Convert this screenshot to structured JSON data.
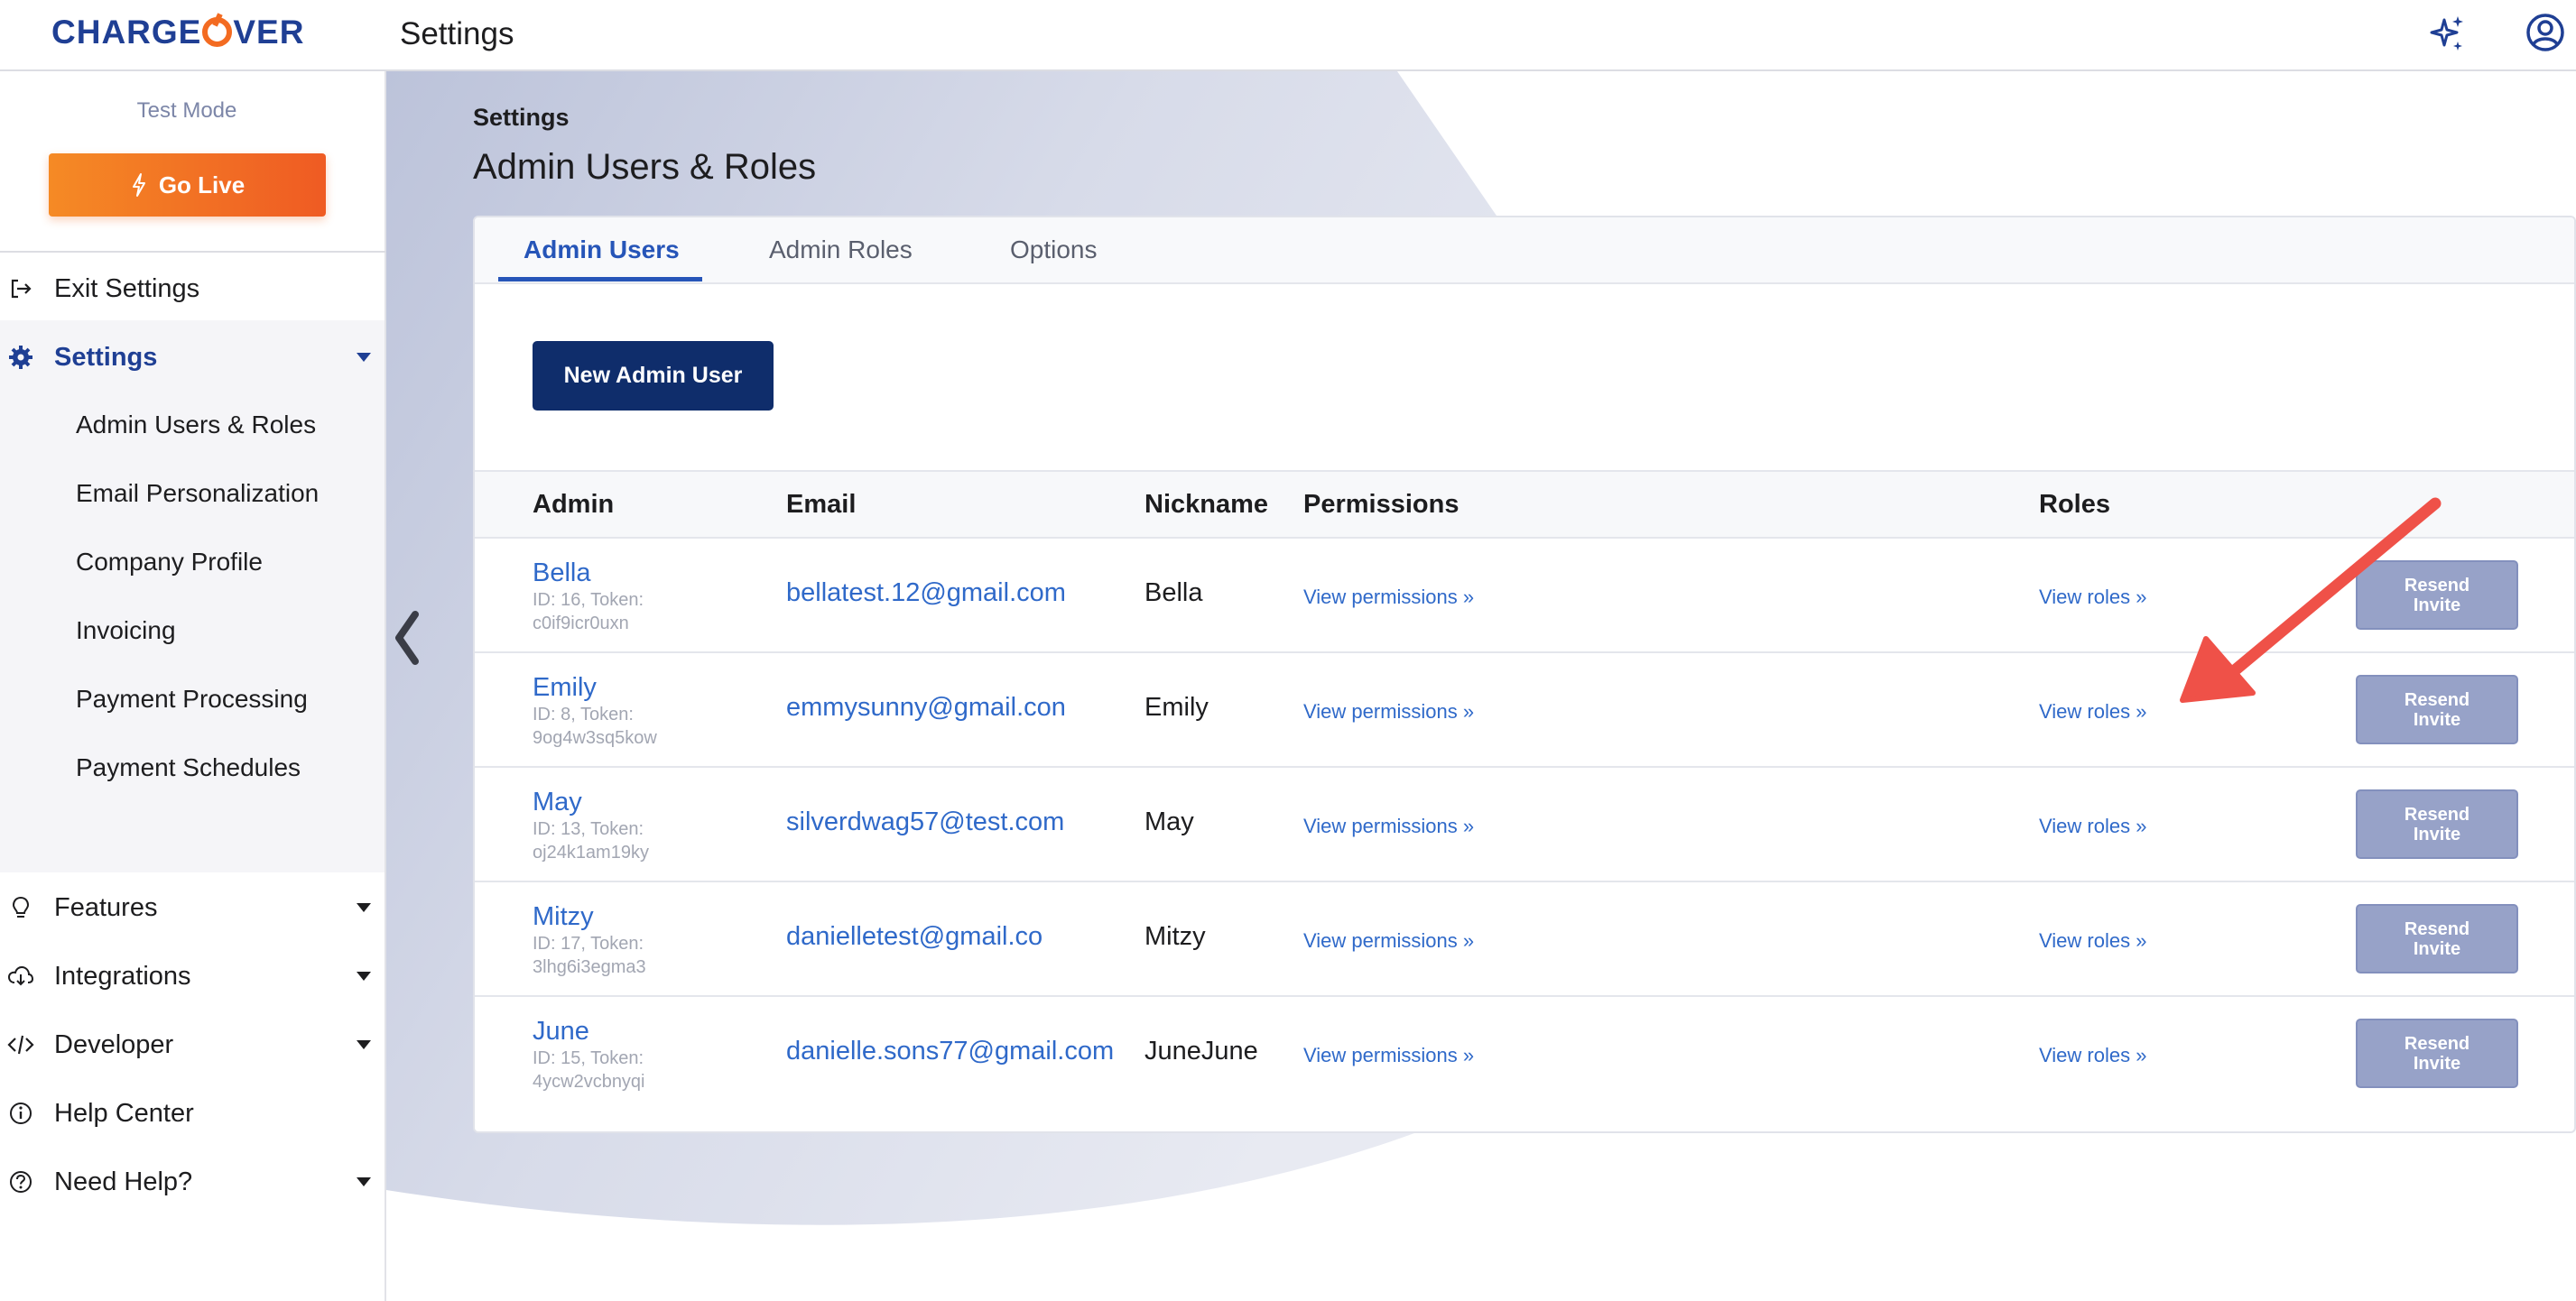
{
  "topbar": {
    "logo_text_left": "CHARGE",
    "logo_text_right": "VER",
    "title": "Settings",
    "icons": [
      "sparkle-icon",
      "user-circle-icon"
    ]
  },
  "sidebar": {
    "test_mode": "Test Mode",
    "go_live": "Go Live",
    "exit_settings": "Exit Settings",
    "settings": "Settings",
    "sub_items": [
      "Admin Users & Roles",
      "Email Personalization",
      "Company Profile",
      "Invoicing",
      "Payment Processing",
      "Payment Schedules"
    ],
    "features": "Features",
    "integrations": "Integrations",
    "developer": "Developer",
    "help_center": "Help Center",
    "need_help": "Need Help?"
  },
  "main": {
    "breadcrumb": "Settings",
    "title": "Admin Users & Roles",
    "tabs": [
      "Admin Users",
      "Admin Roles",
      "Options"
    ],
    "active_tab": "Admin Users",
    "new_button": "New Admin User",
    "columns": [
      "Admin",
      "Email",
      "Nickname",
      "Permissions",
      "Roles"
    ],
    "rows": [
      {
        "name": "Bella",
        "meta1": "ID: 16, Token:",
        "meta2": "c0if9icr0uxn",
        "email": "bellatest.12@gmail.com",
        "nickname": "Bella",
        "permissions": "View permissions »",
        "roles": "View roles »",
        "action": "Resend Invite"
      },
      {
        "name": "Emily",
        "meta1": "ID: 8, Token:",
        "meta2": "9og4w3sq5kow",
        "email": "emmysunny@gmail.con",
        "nickname": "Emily",
        "permissions": "View permissions »",
        "roles": "View roles »",
        "action": "Resend Invite"
      },
      {
        "name": "May",
        "meta1": "ID: 13, Token:",
        "meta2": "oj24k1am19ky",
        "email": "silverdwag57@test.com",
        "nickname": "May",
        "permissions": "View permissions »",
        "roles": "View roles »",
        "action": "Resend Invite"
      },
      {
        "name": "Mitzy",
        "meta1": "ID: 17, Token:",
        "meta2": "3lhg6i3egma3",
        "email": "danielletest@gmail.co",
        "nickname": "Mitzy",
        "permissions": "View permissions »",
        "roles": "View roles »",
        "action": "Resend Invite"
      },
      {
        "name": "June",
        "meta1": "ID: 15, Token:",
        "meta2": "4ycw2vcbnyqi",
        "email": "danielle.sons77@gmail.com",
        "nickname": "JuneJune",
        "permissions": "View permissions »",
        "roles": "View roles »",
        "action": "Resend Invite"
      }
    ]
  },
  "colors": {
    "brand_blue": "#1f3f94",
    "brand_orange": "#f36b21",
    "link_blue": "#2f69c9",
    "primary_button": "#0f2d6b",
    "resend_button": "#97a2c8",
    "annotation_arrow": "#ef5148"
  }
}
